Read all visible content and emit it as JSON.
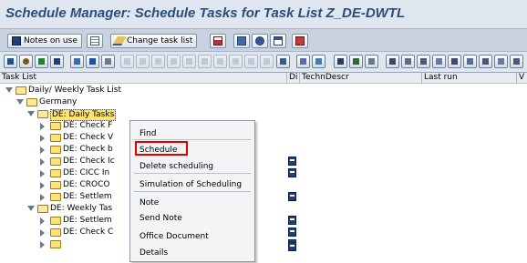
{
  "window": {
    "title": "Schedule Manager: Schedule Tasks for Task List Z_DE-DWTL"
  },
  "toolbar": {
    "notes_label": "Notes on use",
    "change_label": "Change task list"
  },
  "table": {
    "headers": [
      "Task List",
      "Di",
      "TechnDescr",
      "Last run",
      "V"
    ],
    "rows": [
      {
        "label": "Daily/ Weekly Task List"
      },
      {
        "label": "Germany"
      },
      {
        "label": "DE: Daily Tasks"
      },
      {
        "label": "DE: Check F"
      },
      {
        "label": "DE: Check V"
      },
      {
        "label": "DE: Check b"
      },
      {
        "label": "DE: Check Ic"
      },
      {
        "label": "DE: CICC In"
      },
      {
        "label": "DE: CROCO"
      },
      {
        "label": "DE: Settlem"
      },
      {
        "label": "DE: Weekly Tas"
      },
      {
        "label": "DE: Settlem"
      },
      {
        "label": "DE: Check C"
      }
    ]
  },
  "context_menu": {
    "items": [
      {
        "label": "Find"
      },
      {
        "label": "Schedule"
      },
      {
        "label": "Delete scheduling"
      },
      {
        "label": "Simulation of Scheduling"
      },
      {
        "label": "Note"
      },
      {
        "label": "Send Note"
      },
      {
        "label": "Office Document"
      },
      {
        "label": "Details"
      }
    ]
  },
  "colors": {
    "title": "#2a4e7a",
    "highlight": "#ffe36b",
    "callout": "#e00000",
    "folder": "#ffe27a"
  }
}
